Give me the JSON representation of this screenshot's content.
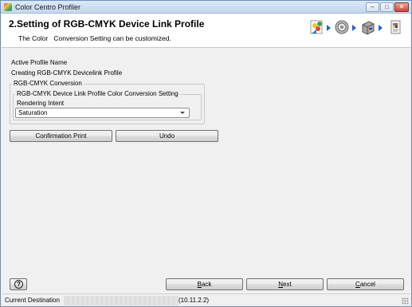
{
  "window": {
    "title": "Color Centro Profiler",
    "minimize_glyph": "–",
    "maximize_glyph": "□",
    "close_glyph": "✕"
  },
  "header": {
    "title": "2.Setting of RGB-CMYK Device Link Profile",
    "subtitle": "The Color   Conversion Setting can be customized.",
    "wizard_steps": [
      "color-wheel-icon",
      "gear-icon",
      "printer-icon",
      "document-profile-icon"
    ],
    "step_accent": "#1f63c7"
  },
  "profile": {
    "label": "Active Profile Name",
    "value": "Creating RGB-CMYK Devicelink Profile"
  },
  "conversion": {
    "group_label": "RGB-CMYK Conversion",
    "inner_group_label": "RGB-CMYK Device Link Profile Color Conversion Setting",
    "rendering_intent_label": "Rendering Intent",
    "rendering_intent_value": "Saturation"
  },
  "actions": {
    "confirmation_print": "Confirmation Print",
    "undo": "Undo"
  },
  "footer": {
    "help": "?",
    "back_prefix": "",
    "back_key": "B",
    "back_rest": "ack",
    "next_key": "N",
    "next_rest": "ext",
    "cancel_key": "C",
    "cancel_rest": "ancel"
  },
  "status": {
    "label": "Current Destination",
    "address": "(10.11.2.2)"
  }
}
